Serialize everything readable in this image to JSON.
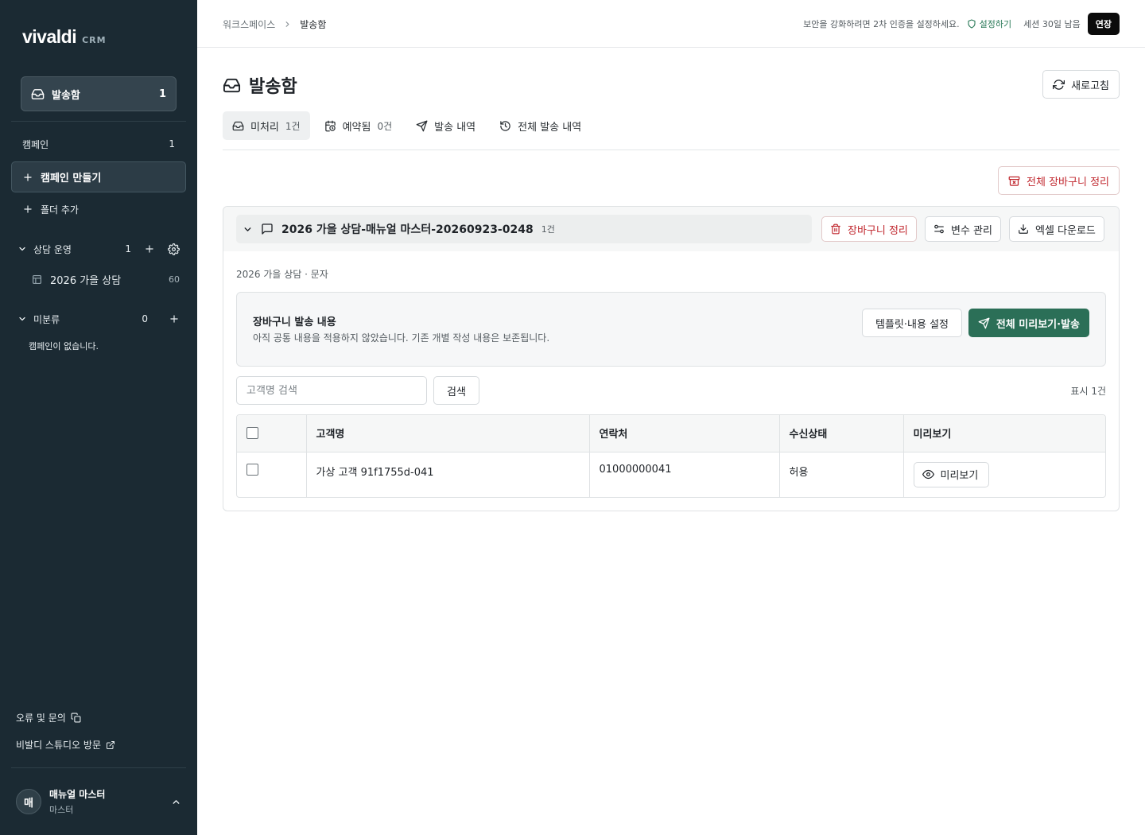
{
  "sidebar": {
    "brand": "vivaldi",
    "brand_suffix": "CRM",
    "outbox": {
      "label": "발송함",
      "count": "1"
    },
    "campaign_section": {
      "label": "캠페인",
      "count": "1"
    },
    "create_campaign": "캠페인 만들기",
    "add_folder": "폴더 추가",
    "folders": [
      {
        "label": "상담 운영",
        "count": "1",
        "items": [
          {
            "label": "2026 가을 상담",
            "count": "60"
          }
        ]
      },
      {
        "label": "미분류",
        "count": "0",
        "empty_text": "캠페인이 없습니다."
      }
    ],
    "footer_links": [
      {
        "label": "오류 및 문의",
        "icon": "copy-icon"
      },
      {
        "label": "비발디 스튜디오 방문",
        "icon": "external-link-icon"
      }
    ],
    "user": {
      "initial": "매",
      "name": "매뉴얼 마스터",
      "role": "마스터"
    }
  },
  "topbar": {
    "breadcrumb": [
      "워크스페이스",
      "발송함"
    ],
    "security_notice": "보안을 강화하려면 2차 인증을 설정하세요.",
    "setup_link": "설정하기",
    "session_text": "세션 30일 남음",
    "extend_button": "연장"
  },
  "page": {
    "title": "발송함",
    "refresh_button": "새로고침",
    "tabs": [
      {
        "label": "미처리",
        "count": "1건",
        "icon": "inbox-icon",
        "active": true
      },
      {
        "label": "예약됨",
        "count": "0건",
        "icon": "calendar-clock-icon",
        "active": false
      },
      {
        "label": "발송 내역",
        "count": "",
        "icon": "send-icon",
        "active": false
      },
      {
        "label": "전체 발송 내역",
        "count": "",
        "icon": "history-icon",
        "active": false
      }
    ],
    "clear_all_button": "전체 장바구니 정리"
  },
  "group": {
    "title": "2026 가을 상담-매뉴얼 마스터-20260923-0248",
    "count": "1건",
    "actions": {
      "clear": "장바구니 정리",
      "variables": "변수 관리",
      "excel": "엑셀 다운로드"
    },
    "subtitle": "2026 가을 상담 · 문자",
    "cart": {
      "title": "장바구니 발송 내용",
      "description": "아직 공통 내용을 적용하지 않았습니다. 기존 개별 작성 내용은 보존됩니다.",
      "template_button": "템플릿·내용 설정",
      "send_button": "전체 미리보기·발송"
    },
    "search": {
      "placeholder": "고객명 검색",
      "value": "",
      "button": "검색"
    },
    "display_count": "표시 1건",
    "table": {
      "columns": [
        "고객명",
        "연락처",
        "수신상태",
        "미리보기"
      ],
      "rows": [
        {
          "name": "가상 고객 91f1755d-041",
          "phone": "01000000041",
          "status": "허용",
          "preview": "미리보기"
        }
      ]
    }
  },
  "colors": {
    "sidebar_bg": "#1b2a33",
    "accent_green": "#2b6f57",
    "danger_red": "#c0262d"
  }
}
